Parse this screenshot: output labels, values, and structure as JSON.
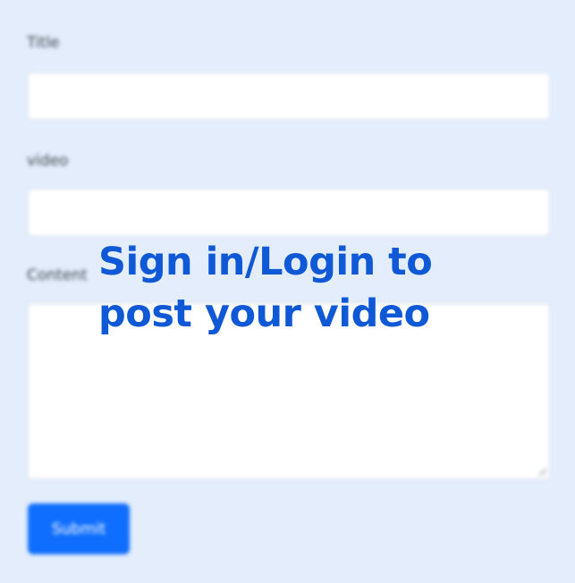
{
  "form": {
    "title_label": "Title",
    "title_value": "",
    "video_label": "video",
    "video_value": "",
    "content_label": "Content",
    "content_value": "",
    "submit_label": "Submit"
  },
  "overlay": {
    "line1": "Sign in/Login to",
    "line2": "post your video"
  },
  "colors": {
    "background": "#e3edfb",
    "accent": "#0f6efd",
    "overlay_text": "#0f59d6"
  }
}
